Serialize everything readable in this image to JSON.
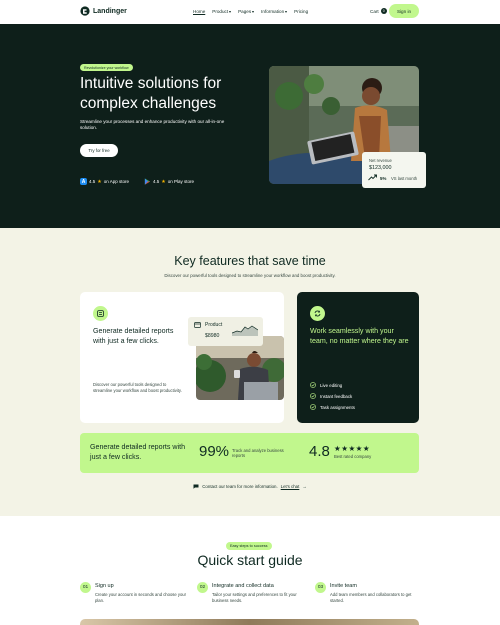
{
  "nav": {
    "brand": "Landinger",
    "links": [
      {
        "label": "Home"
      },
      {
        "label": "Product"
      },
      {
        "label": "Pages"
      },
      {
        "label": "Information"
      },
      {
        "label": "Pricing"
      }
    ],
    "cart_label": "Cart",
    "cart_count": "0",
    "signin_label": "Sign in"
  },
  "hero": {
    "pill": "Revolutionize your workflow",
    "title": "Intuitive solutions for complex challenges",
    "subtitle": "Streamline your processes and enhance productivity with our all-in-one solution.",
    "cta": "Try for free",
    "app_store": {
      "rating": "4.5",
      "label": "on App store"
    },
    "play_store": {
      "rating": "4.5",
      "label": "on Play store"
    },
    "revenue_card": {
      "label": "Net revenue",
      "value": "$123,000",
      "pct": "5%",
      "vs": "VS last month"
    }
  },
  "features": {
    "title": "Key features that save time",
    "subtitle": "Discover our powerful tools designed to streamline your workflow and boost productivity.",
    "card1": {
      "title": "Generate detailed reports with just a few clicks.",
      "desc": "Discover our powerful tools designed to streamline your workflow and boost productivity.",
      "product_label": "Product",
      "product_value": "$8980"
    },
    "card2": {
      "title": "Work seamlessly with your team, no matter where they are",
      "items": [
        "Live editing",
        "Instant feedback",
        "Task assignments"
      ]
    },
    "band": {
      "title": "Generate detailed reports with just a few clicks.",
      "stat1": "99%",
      "stat1_text": "Track and analyze business reports",
      "stat2": "4.8",
      "stars": "★★★★★",
      "stat2_text": "Best rated company"
    },
    "contact_text": "Contact our team for more information.",
    "contact_link": "Let's chat",
    "arrow": "→"
  },
  "quickstart": {
    "pill": "Easy steps to success",
    "title": "Quick start guide",
    "steps": [
      {
        "num": "01",
        "title": "Sign up",
        "desc": "Create your account in seconds and choose your plan."
      },
      {
        "num": "02",
        "title": "Integrate and collect data",
        "desc": "Tailor your settings and preferences to fit your business needs."
      },
      {
        "num": "03",
        "title": "Invite team",
        "desc": "Add team members and collaborators to get started."
      }
    ]
  },
  "colors": {
    "dark": "#0e1f1a",
    "accent": "#c1f78d",
    "cream": "#f3f3e6"
  }
}
